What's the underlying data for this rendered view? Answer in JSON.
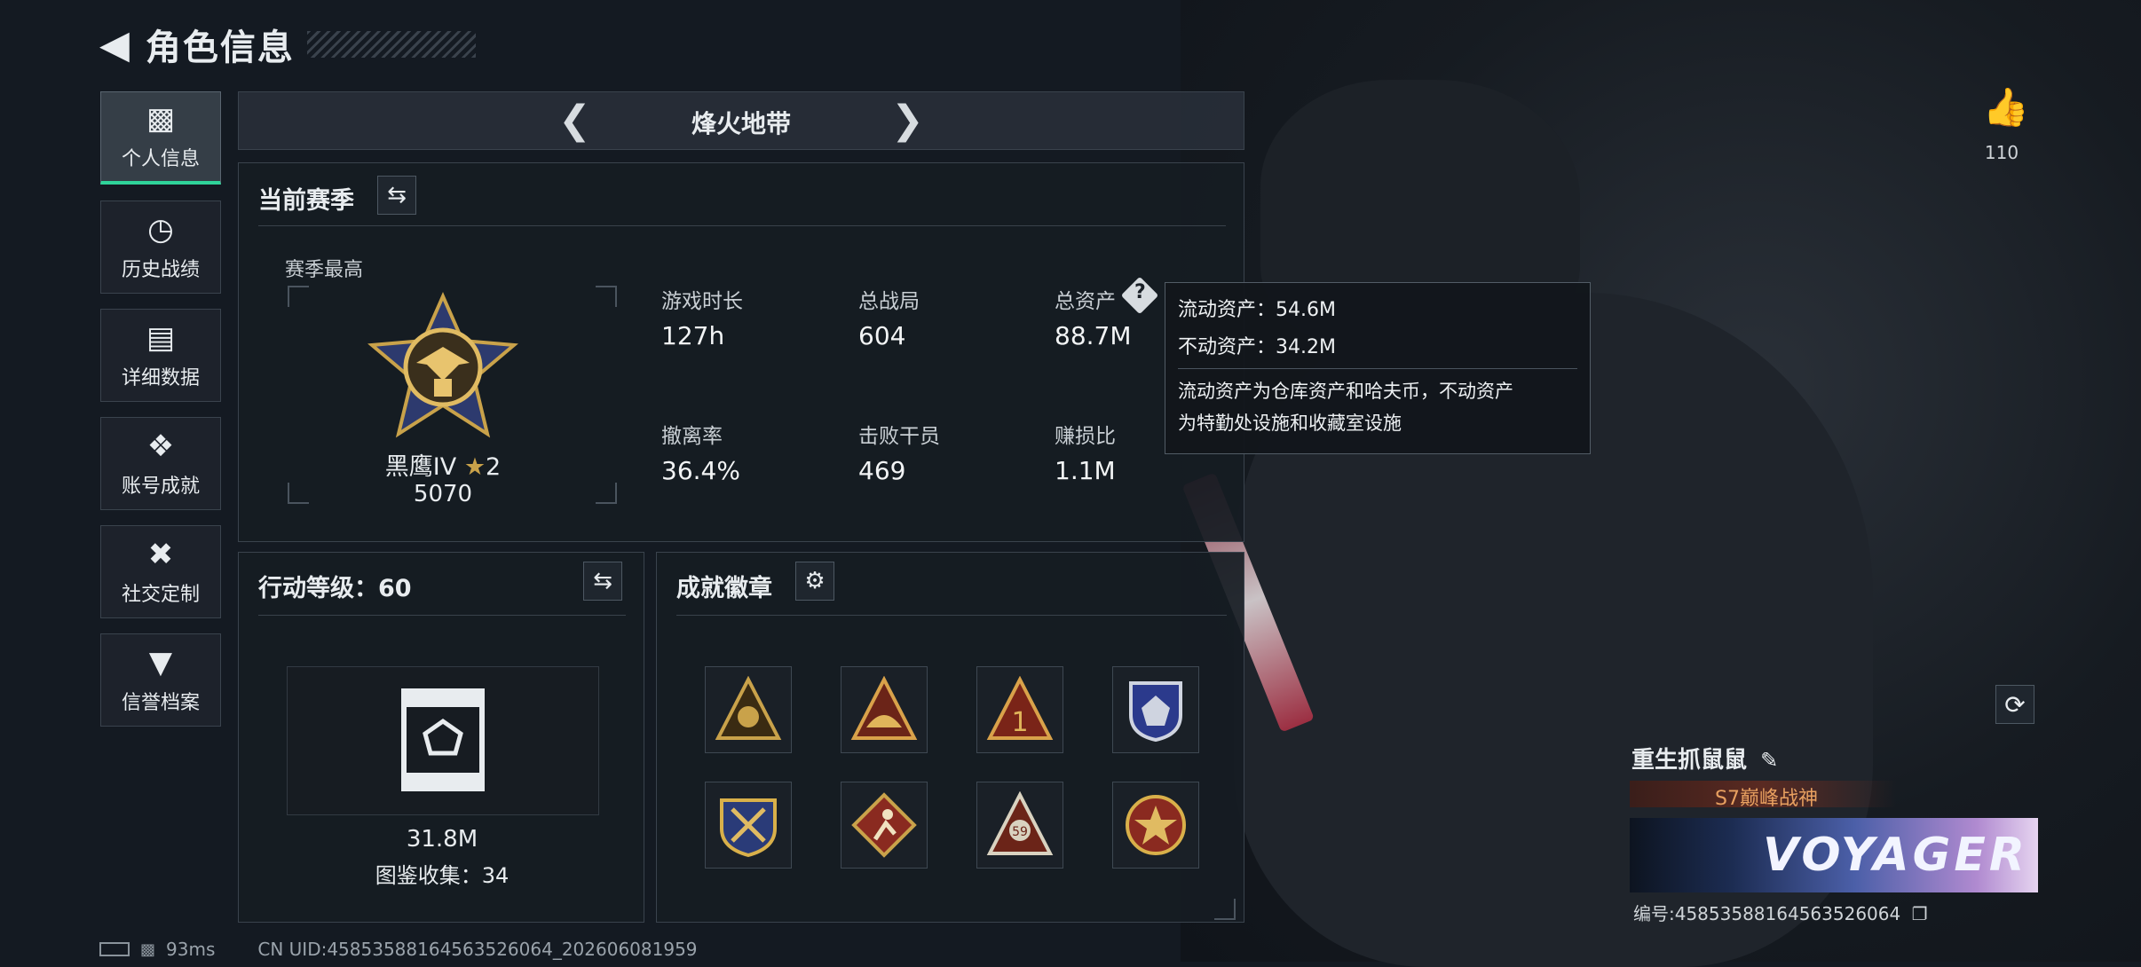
{
  "header": {
    "title": "角色信息"
  },
  "nav": {
    "items": [
      {
        "label": "个人信息",
        "icon": "bar-chart-icon"
      },
      {
        "label": "历史战绩",
        "icon": "history-icon"
      },
      {
        "label": "详细数据",
        "icon": "folder-icon"
      },
      {
        "label": "账号成就",
        "icon": "achievement-icon"
      },
      {
        "label": "社交定制",
        "icon": "tools-icon"
      },
      {
        "label": "信誉档案",
        "icon": "shield-icon"
      }
    ]
  },
  "mode_selector": {
    "label": "烽火地带",
    "prev_icon": "chevron-left-icon",
    "next_icon": "chevron-right-icon"
  },
  "season": {
    "title": "当前赛季",
    "best_label": "赛季最高",
    "rank_name": "黑鹰IV",
    "rank_stars": "2",
    "rank_points": "5070",
    "stats": [
      {
        "label": "游戏时长",
        "value": "127h"
      },
      {
        "label": "总战局",
        "value": "604"
      },
      {
        "label": "总资产",
        "value": "88.7M"
      },
      {
        "label": "撤离率",
        "value": "36.4%"
      },
      {
        "label": "击败干员",
        "value": "469"
      },
      {
        "label": "赚损比",
        "value": "1.1M"
      }
    ]
  },
  "tooltip": {
    "liquid": "流动资产：54.6M",
    "fixed": "不动资产：34.2M",
    "note_line1": "流动资产为仓库资产和哈夫币，不动资产",
    "note_line2": "为特勤处设施和收藏室设施"
  },
  "action_level": {
    "title": "行动等级：60",
    "value": "31.8M",
    "collection": "图鉴收集：34"
  },
  "badges": {
    "title": "成就徽章",
    "items": [
      "skull-badge-icon",
      "sunrise-badge-icon",
      "number-one-badge-icon",
      "wolf-badge-icon",
      "crossed-arrows-badge-icon",
      "runner-badge-icon",
      "level-59-badge-icon",
      "star-badge-icon"
    ]
  },
  "likes": {
    "count": "110"
  },
  "profile": {
    "name": "重生抓鼠鼠",
    "title_tag": "S7巅峰战神",
    "banner_text": "VOYAGER",
    "id_label": "编号:4585358816456352606​4"
  },
  "status": {
    "ping": "93ms",
    "uid": "CN UID:4585358816456352606​4_202606081959"
  },
  "colors": {
    "accent": "#2fd39a",
    "gold": "#c9a24a",
    "tooltip_bg": "#12161b"
  }
}
